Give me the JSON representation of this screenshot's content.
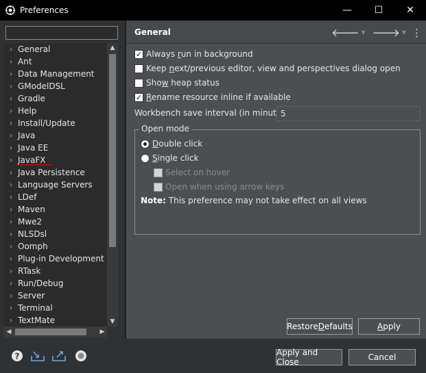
{
  "window": {
    "title": "Preferences",
    "controls": {
      "minimize": "—",
      "maximize": "☐",
      "close": "✕"
    }
  },
  "filter": {
    "value": "",
    "placeholder": ""
  },
  "tree": {
    "items": [
      {
        "label": "General"
      },
      {
        "label": "Ant"
      },
      {
        "label": "Data Management"
      },
      {
        "label": "GModelDSL"
      },
      {
        "label": "Gradle"
      },
      {
        "label": "Help"
      },
      {
        "label": "Install/Update"
      },
      {
        "label": "Java"
      },
      {
        "label": "Java EE"
      },
      {
        "label": "JavaFX"
      },
      {
        "label": "Java Persistence"
      },
      {
        "label": "Language Servers"
      },
      {
        "label": "LDef"
      },
      {
        "label": "Maven"
      },
      {
        "label": "Mwe2"
      },
      {
        "label": "NLSDsl"
      },
      {
        "label": "Oomph"
      },
      {
        "label": "Plug-in Development"
      },
      {
        "label": "RTask"
      },
      {
        "label": "Run/Debug"
      },
      {
        "label": "Server"
      },
      {
        "label": "Terminal"
      },
      {
        "label": "TextMate"
      }
    ]
  },
  "page": {
    "title": "General",
    "options": {
      "always_run_bg": {
        "label_pre": "Always ",
        "mnemonic": "r",
        "label_post": "un in background",
        "checked": true
      },
      "keep_next_prev": {
        "label_pre": "Keep ",
        "mnemonic": "n",
        "label_post": "ext/previous editor, view and perspectives dialog open",
        "checked": false
      },
      "show_heap": {
        "label_pre": "Sho",
        "mnemonic": "w",
        "label_post": " heap status",
        "checked": false
      },
      "rename_inline": {
        "label_pre": "",
        "mnemonic": "R",
        "label_post": "ename resource inline if available",
        "checked": true
      }
    },
    "interval": {
      "label": "Workbench save interval (in minutes):",
      "value": "5"
    },
    "open_mode": {
      "legend": "Open mode",
      "double_click": {
        "mnemonic": "D",
        "label_post": "ouble click",
        "selected": true
      },
      "single_click": {
        "mnemonic": "S",
        "label_post": "ingle click",
        "selected": false
      },
      "select_on_hover": "Select on hover",
      "open_arrow_keys": "Open when using arrow keys"
    },
    "note": {
      "bold": "Note:",
      "text": " This preference may not take effect on all views"
    }
  },
  "buttons": {
    "restore_pre": "Restore ",
    "restore_mnemonic": "D",
    "restore_post": "efaults",
    "apply_mnemonic": "A",
    "apply_post": "pply",
    "apply_close": "Apply and Close",
    "cancel": "Cancel"
  },
  "colors": {
    "accent_check": "#e00000",
    "panel_bg": "#4c4f52",
    "tree_bg": "#2b2b2b"
  }
}
